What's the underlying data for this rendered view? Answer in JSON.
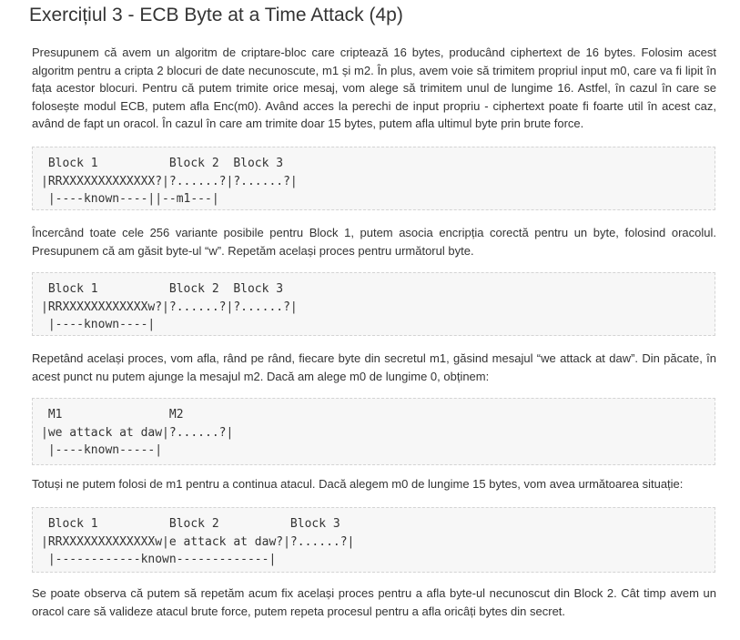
{
  "heading": "Exercițiul 3 - ECB Byte at a Time Attack (4p)",
  "paragraphs": [
    "Presupunem că avem un algoritm de criptare-bloc care criptează 16 bytes, producând ciphertext de 16 bytes. Folosim acest algoritm pentru a cripta 2 blocuri de date necunoscute, m1 și m2. În plus, avem voie să trimitem propriul input m0, care va fi lipit în fața acestor blocuri. Pentru că putem trimite orice mesaj, vom alege să trimitem unul de lungime 16. Astfel, în cazul în care se folosește modul ECB, putem afla Enc(m0). Având acces la perechi de input propriu - ciphertext poate fi foarte util în acest caz, având de fapt un oracol. În cazul în care am trimite doar 15 bytes, putem afla ultimul byte prin brute force.",
    "Încercând toate cele 256 variante posibile pentru Block 1, putem asocia encripția corectă pentru un byte, folosind oracolul. Presupunem că am găsit byte-ul “w”. Repetăm același proces pentru următorul byte.",
    "Repetând același proces, vom afla, rând pe rând, fiecare byte din secretul m1, găsind mesajul “we attack at daw”. Din păcate, în acest punct nu putem ajunge la mesajul m2. Dacă am alege m0 de lungime 0, obținem:",
    "Totuși ne putem folosi de m1 pentru a continua atacul. Dacă alegem m0 de lungime 15 bytes, vom avea următoarea situație:",
    "Se poate observa că putem să repetăm acum fix același proces pentru a afla byte-ul necunoscut din Block 2. Cât timp avem un oracol care să valideze atacul brute force, putem repeta procesul pentru a afla oricâți bytes din secret."
  ],
  "code_blocks": [
    {
      "lines": [
        " Block 1          Block 2  Block 3",
        "|RRXXXXXXXXXXXXX?|?......?|?......?|",
        " |----known----||--m1---|"
      ]
    },
    {
      "lines": [
        " Block 1          Block 2  Block 3",
        "|RRXXXXXXXXXXXXw?|?......?|?......?|",
        " |----known----|"
      ]
    },
    {
      "lines": [
        " M1               M2",
        "|we attack at daw|?......?|",
        " |----known-----|"
      ]
    },
    {
      "lines": [
        " Block 1          Block 2          Block 3",
        "|RRXXXXXXXXXXXXXw|e attack at daw?|?......?|",
        " |------------known-------------|"
      ]
    }
  ]
}
